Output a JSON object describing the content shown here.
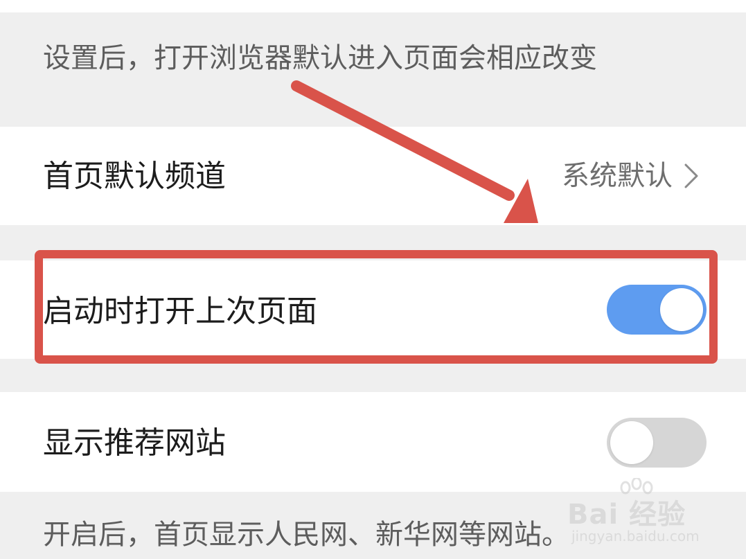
{
  "default_page_hint": "设置后，打开浏览器默认进入页面会相应改变",
  "homepage_channel": {
    "label": "首页默认频道",
    "value": "系统默认"
  },
  "restore_last_page": {
    "label": "启动时打开上次页面",
    "enabled": true
  },
  "show_recommended_sites": {
    "label": "显示推荐网站",
    "enabled": false
  },
  "recommended_sites_hint": "开启后，首页显示人民网、新华网等网站。",
  "watermark": {
    "brand": "Bai 经验",
    "url": "jingyan.baidu.com"
  },
  "colors": {
    "toggle_on": "#5e9cf0",
    "toggle_off": "#d6d6d6",
    "annotation": "#d9534a"
  }
}
